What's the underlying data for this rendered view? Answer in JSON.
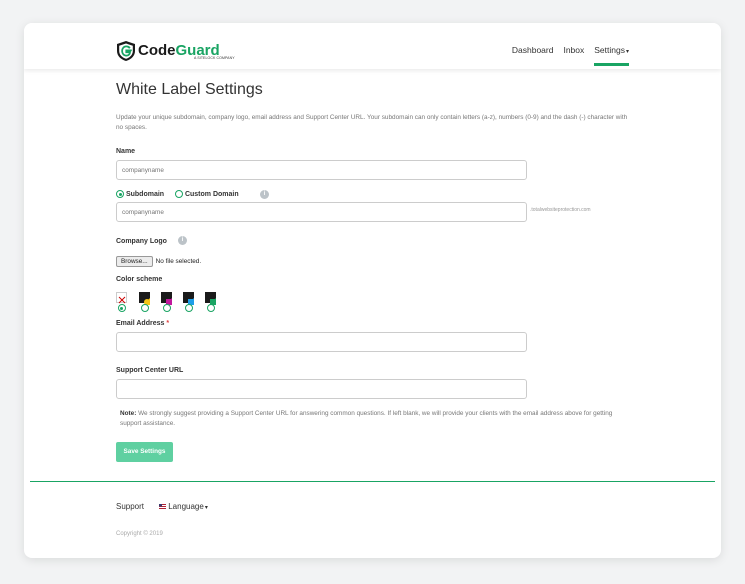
{
  "brand": {
    "name_part1": "Code",
    "name_part2": "Guard",
    "sub": "A SITELOCK COMPANY",
    "accent": "#19a463"
  },
  "nav": {
    "dashboard": "Dashboard",
    "inbox": "Inbox",
    "settings": "Settings"
  },
  "page": {
    "title": "White Label Settings",
    "description": "Update your unique subdomain, company logo, email address and Support Center URL. Your subdomain can only contain letters (a-z), numbers (0-9) and the dash (-) character with no spaces."
  },
  "form": {
    "name_label": "Name",
    "name_placeholder": "companyname",
    "subdomain_label": "Subdomain",
    "custom_domain_label": "Custom Domain",
    "domain_placeholder": "companyname",
    "domain_suffix": ".totalwebsiteprotection.com",
    "logo_label": "Company Logo",
    "browse_label": "Browse...",
    "no_file_label": "No file selected.",
    "color_label": "Color scheme",
    "email_label": "Email Address",
    "required_mark": "*",
    "support_label": "Support Center URL",
    "note_label": "Note:",
    "note_text": " We strongly suggest providing a Support Center URL for answering common questions. If left blank, we will provide your clients with the email address above for getting support assistance.",
    "save_label": "Save Settings"
  },
  "color_schemes": [
    {
      "name": "none",
      "accent": "#cc0000"
    },
    {
      "name": "yellow",
      "accent": "#f5c518"
    },
    {
      "name": "magenta",
      "accent": "#c0189c"
    },
    {
      "name": "blue",
      "accent": "#1e9ee8"
    },
    {
      "name": "green",
      "accent": "#19a463"
    }
  ],
  "footer": {
    "support": "Support",
    "language": "Language",
    "copyright": "Copyright © 2019"
  }
}
